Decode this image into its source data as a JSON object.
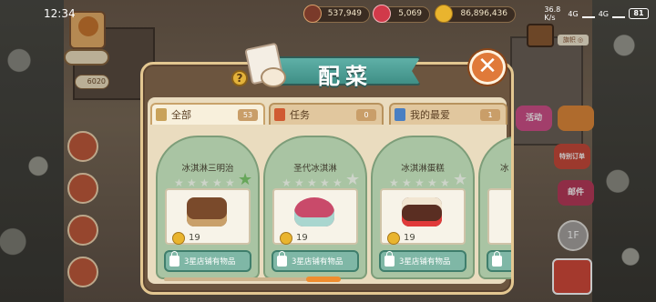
{
  "status_bar": {
    "time": "12:34",
    "network_speed": "36.8 K/s",
    "signal_1": "4G",
    "signal_2": "4G",
    "battery": "81"
  },
  "currency": {
    "gems": "537,949",
    "hearts": "5,069",
    "coins": "86,896,436"
  },
  "hud": {
    "coin_count": "6020",
    "flag_label": "旗帜 ◎",
    "floor_label": "1F",
    "side_labels": [
      "活动",
      "特别订单",
      "邮件"
    ]
  },
  "dialog": {
    "title": "配菜",
    "tabs": [
      {
        "label": "全部",
        "count": "53",
        "icon_color": "#c9a25a"
      },
      {
        "label": "任务",
        "count": "0",
        "icon_color": "#d05a32"
      },
      {
        "label": "我的最爱",
        "count": "1",
        "icon_color": "#4a7fc2"
      }
    ],
    "cards": [
      {
        "name": "冰淇淋三明治",
        "price": "19",
        "unlock_text": "3星店铺有物品",
        "favorite": true,
        "food_icon": "ice-cream-sandwich",
        "food_color": "#7a4a2b"
      },
      {
        "name": "圣代冰淇淋",
        "price": "19",
        "unlock_text": "3星店铺有物品",
        "favorite": false,
        "food_icon": "sundae",
        "food_color": "#c94a6a"
      },
      {
        "name": "冰淇淋蛋糕",
        "price": "19",
        "unlock_text": "3星店铺有物品",
        "favorite": false,
        "food_icon": "ice-cream-cake",
        "food_color": "#5a2e22"
      },
      {
        "name": "冰",
        "price": "",
        "unlock_text": "",
        "favorite": false,
        "food_icon": "partial",
        "food_color": "#a9c4a3"
      }
    ]
  },
  "colors": {
    "dialog_border": "#e3c791",
    "card_green": "#a9c4a3",
    "unlock_teal": "#7fb7a6",
    "ribbon_teal": "#4fa096",
    "close_orange": "#e07a3a"
  }
}
